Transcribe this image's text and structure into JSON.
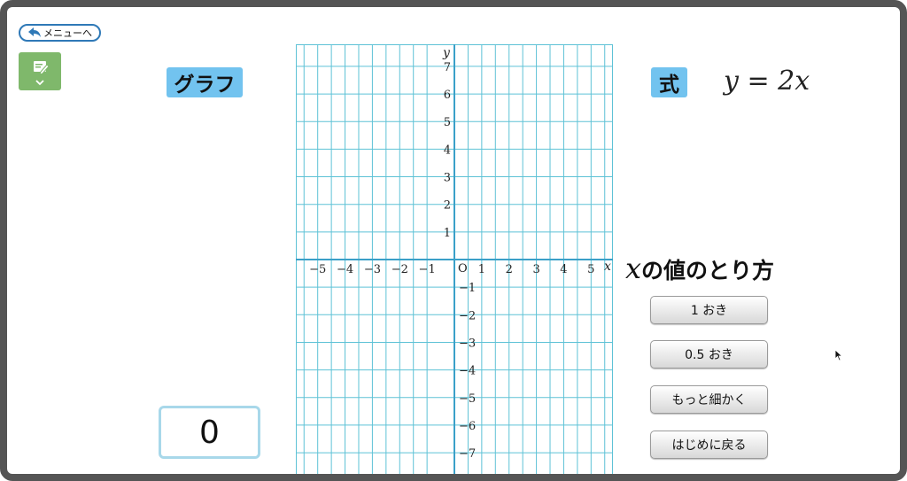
{
  "nav": {
    "menu_label": "メニューへ"
  },
  "graph_label": "グラフ",
  "formula": {
    "label": "式",
    "expression": "y = 2x"
  },
  "grid": {
    "x_axis_label": "x",
    "y_axis_label": "y",
    "origin_label": "O",
    "x_range": [
      -5.8,
      5.8
    ],
    "y_range": [
      -7.8,
      7.8
    ],
    "x_ticks": [
      -5,
      -4,
      -3,
      -2,
      -1,
      1,
      2,
      3,
      4,
      5
    ],
    "y_ticks": [
      -7,
      -6,
      -5,
      -4,
      -3,
      -2,
      -1,
      1,
      2,
      3,
      4,
      5,
      6,
      7
    ],
    "grid_color": "#5ec2d6",
    "axis_color": "#3aa0c8"
  },
  "x_step": {
    "title_var": "x",
    "title_rest": "の値のとり方",
    "buttons": [
      "1 おき",
      "0.5 おき",
      "もっと細かく",
      "はじめに戻る"
    ]
  },
  "counter": {
    "value": "0"
  }
}
